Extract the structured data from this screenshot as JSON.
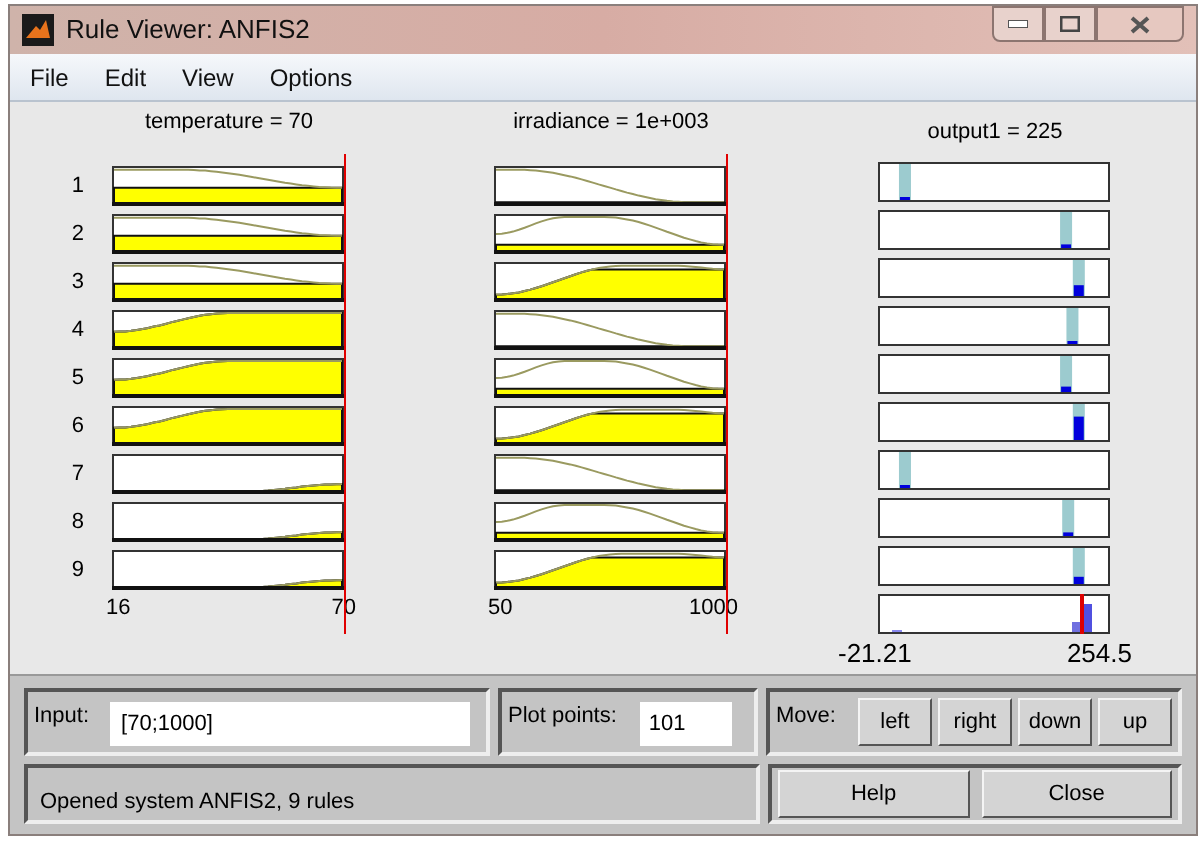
{
  "window": {
    "title": "Rule Viewer: ANFIS2"
  },
  "menu": [
    "File",
    "Edit",
    "View",
    "Options"
  ],
  "inputs": [
    {
      "label": "temperature = 70",
      "range_min": "16",
      "range_max": "70"
    },
    {
      "label": "irradiance = 1e+003",
      "range_min": "50",
      "range_max": "1000"
    }
  ],
  "output": {
    "label": "output1 = 225",
    "range_min": "-21.21",
    "range_max": "254.5"
  },
  "rules": [
    "1",
    "2",
    "3",
    "4",
    "5",
    "6",
    "7",
    "8",
    "9"
  ],
  "input_field": {
    "label": "Input:",
    "value": "[70;1000]"
  },
  "plot_points": {
    "label": "Plot points:",
    "value": "101"
  },
  "move": {
    "label": "Move:",
    "buttons": [
      "left",
      "right",
      "down",
      "up"
    ]
  },
  "status": "Opened system ANFIS2, 9 rules",
  "buttons": [
    "Help",
    "Close"
  ]
}
